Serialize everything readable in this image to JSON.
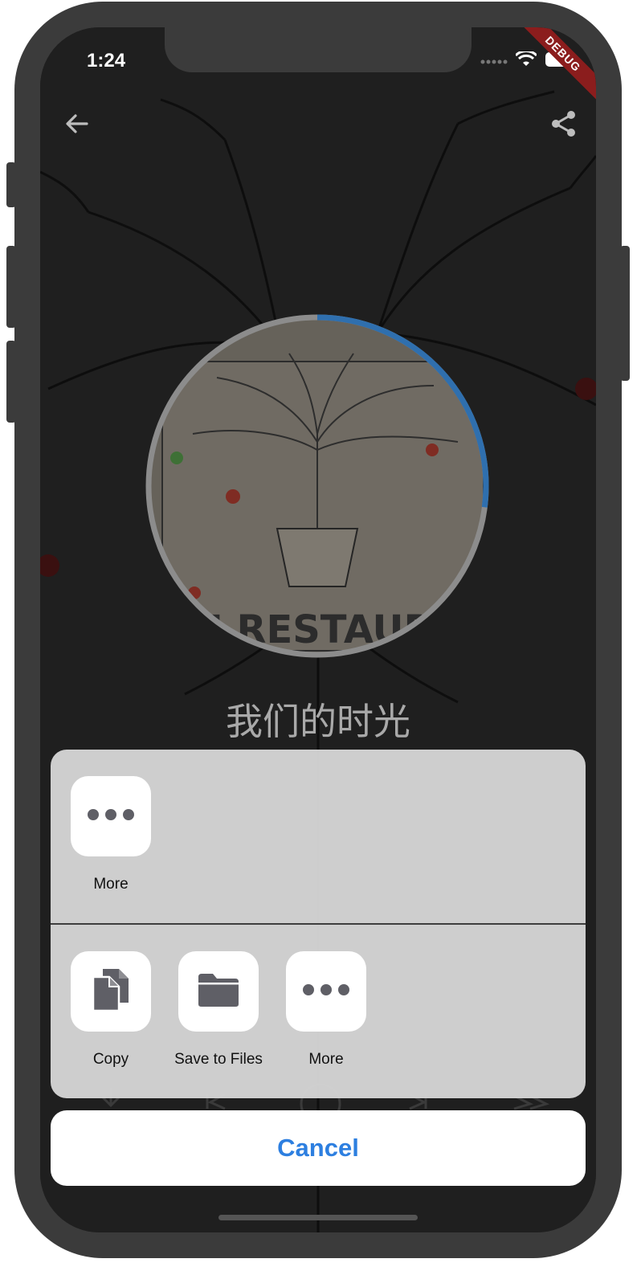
{
  "status_bar": {
    "time": "1:24",
    "signal": "signal-dots-icon",
    "wifi": "wifi-icon",
    "battery": "battery-icon",
    "debug_banner": "DEBUG"
  },
  "player": {
    "back_icon": "arrow-back-icon",
    "share_icon": "share-icon",
    "album_art_text": "M RESTAURAN",
    "song_title": "我们的时光",
    "progress": 0.27,
    "accent_color": "#2f6fae"
  },
  "share_sheet": {
    "row1": [
      {
        "label": "More",
        "icon": "more-dots-icon"
      }
    ],
    "row2": [
      {
        "label": "Copy",
        "icon": "copy-icon"
      },
      {
        "label": "Save to Files",
        "icon": "folder-icon"
      },
      {
        "label": "More",
        "icon": "more-dots-icon"
      }
    ],
    "cancel_label": "Cancel",
    "cancel_color": "#2d7fe0"
  }
}
